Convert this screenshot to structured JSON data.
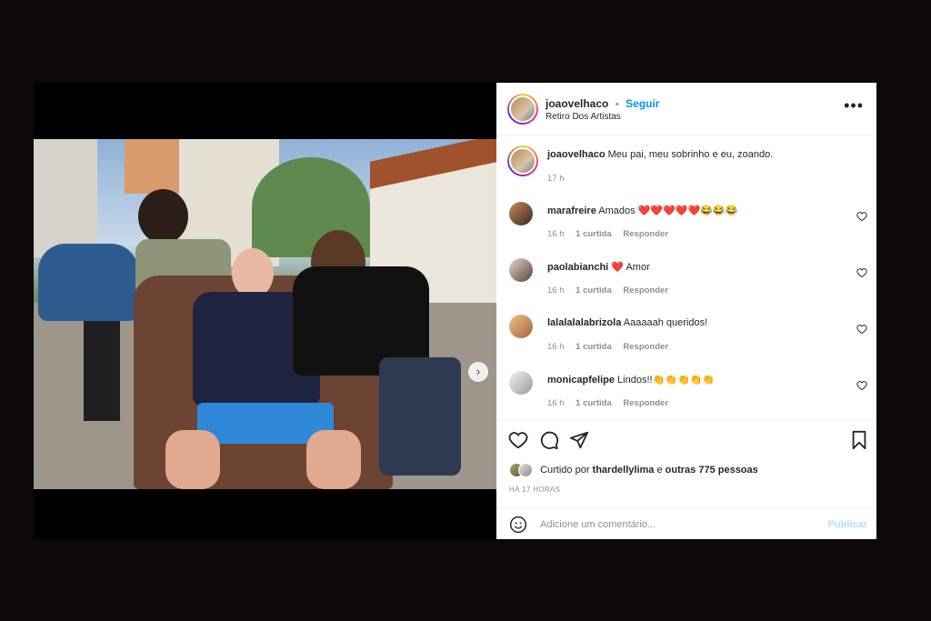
{
  "post": {
    "username": "joaovelhaco",
    "follow_label": "Seguir",
    "separator": "•",
    "location": "Retiro Dos Artistas",
    "more_glyph": "•••",
    "caption": {
      "username": "joaovelhaco",
      "text": "Meu pai, meu sobrinho e eu, zoando.",
      "time": "17 h"
    },
    "carousel": {
      "slide_count": 5,
      "active_index": 0,
      "next_glyph": "›"
    }
  },
  "comments": [
    {
      "username": "marafreire",
      "text": "Amados ❤️❤️❤️❤️❤️😂😂😂",
      "time": "16 h",
      "likes": "1 curtida",
      "reply": "Responder"
    },
    {
      "username": "paolabianchi",
      "text": "❤️ Amor",
      "time": "16 h",
      "likes": "1 curtida",
      "reply": "Responder"
    },
    {
      "username": "lalalalalabrizola",
      "text": "Aaaaaah queridos!",
      "time": "16 h",
      "likes": "1 curtida",
      "reply": "Responder"
    },
    {
      "username": "monicapfelipe",
      "text": "Lindos!!👏👏👏👏👏",
      "time": "16 h",
      "likes": "1 curtida",
      "reply": "Responder"
    }
  ],
  "likes": {
    "prefix": "Curtido por",
    "user": "thardellylima",
    "middle": "e",
    "others": "outras 775 pessoas"
  },
  "time_ago": "HÁ 17 HORAS",
  "add_comment": {
    "placeholder": "Adicione um comentário...",
    "post_label": "Publicar"
  },
  "icons": [
    "heart-icon",
    "comment-icon",
    "share-icon",
    "bookmark-icon",
    "emoji-icon",
    "more-icon"
  ],
  "colors": {
    "link": "#0095f6",
    "muted": "#8e8e8e",
    "text": "#262626"
  }
}
